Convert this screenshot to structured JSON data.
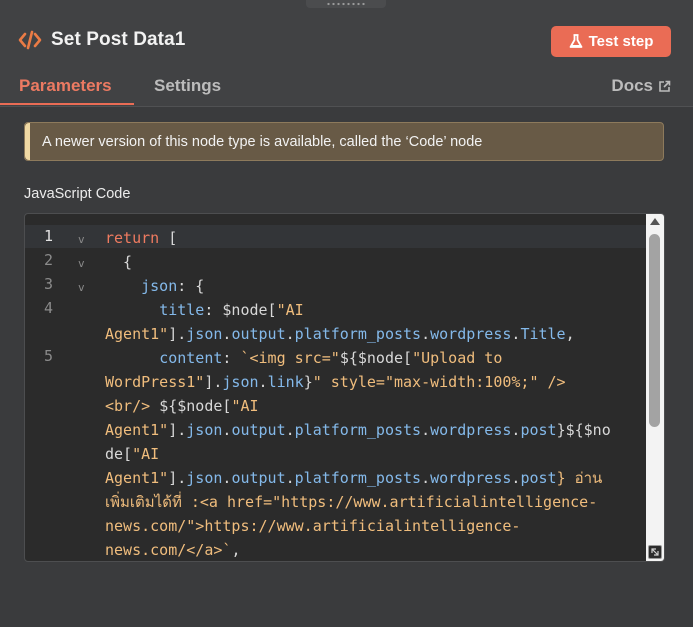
{
  "header": {
    "title": "Set Post Data1",
    "test_button_label": "Test step",
    "icon": "code-icon",
    "accent_color": "#ea6c55"
  },
  "tabs": [
    {
      "label": "Parameters",
      "active": true
    },
    {
      "label": "Settings",
      "active": false
    }
  ],
  "docs": {
    "label": "Docs",
    "icon": "external-link-icon"
  },
  "notice": {
    "text": "A newer version of this node type is available, called the ‘Code’ node"
  },
  "editor": {
    "label": "JavaScript Code",
    "line_numbers": [
      "1",
      "2",
      "3",
      "4",
      "5"
    ],
    "fold_markers": [
      "v",
      "v",
      "v"
    ],
    "lines": [
      [
        {
          "t": "return",
          "c": "kw"
        },
        {
          "t": " [",
          "c": ""
        }
      ],
      [
        {
          "t": "  {",
          "c": ""
        }
      ],
      [
        {
          "t": "    ",
          "c": ""
        },
        {
          "t": "json",
          "c": "prop"
        },
        {
          "t": ": {",
          "c": ""
        }
      ],
      [
        {
          "t": "      ",
          "c": ""
        },
        {
          "t": "title",
          "c": "prop"
        },
        {
          "t": ": $node[",
          "c": ""
        },
        {
          "t": "\"AI",
          "c": "str"
        }
      ],
      [
        {
          "t": "Agent1\"",
          "c": "str"
        },
        {
          "t": "].",
          "c": ""
        },
        {
          "t": "json",
          "c": "prop"
        },
        {
          "t": ".",
          "c": ""
        },
        {
          "t": "output",
          "c": "prop"
        },
        {
          "t": ".",
          "c": ""
        },
        {
          "t": "platform_posts",
          "c": "prop"
        },
        {
          "t": ".",
          "c": ""
        },
        {
          "t": "wordpress",
          "c": "prop"
        },
        {
          "t": ".",
          "c": ""
        },
        {
          "t": "Title",
          "c": "prop"
        },
        {
          "t": ",",
          "c": ""
        }
      ],
      [
        {
          "t": "      ",
          "c": ""
        },
        {
          "t": "content",
          "c": "prop"
        },
        {
          "t": ": ",
          "c": ""
        },
        {
          "t": "`<img src=\"",
          "c": "str"
        },
        {
          "t": "${$node[",
          "c": ""
        },
        {
          "t": "\"Upload to",
          "c": "str"
        }
      ],
      [
        {
          "t": "WordPress1\"",
          "c": "str"
        },
        {
          "t": "].",
          "c": ""
        },
        {
          "t": "json",
          "c": "prop"
        },
        {
          "t": ".",
          "c": ""
        },
        {
          "t": "link",
          "c": "prop"
        },
        {
          "t": "}",
          "c": ""
        },
        {
          "t": "\" style=\"max-width:100%;\" />",
          "c": "str"
        }
      ],
      [
        {
          "t": "<br/> ",
          "c": "str"
        },
        {
          "t": "${$node[",
          "c": ""
        },
        {
          "t": "\"AI",
          "c": "str"
        }
      ],
      [
        {
          "t": "Agent1\"",
          "c": "str"
        },
        {
          "t": "].",
          "c": ""
        },
        {
          "t": "json",
          "c": "prop"
        },
        {
          "t": ".",
          "c": ""
        },
        {
          "t": "output",
          "c": "prop"
        },
        {
          "t": ".",
          "c": ""
        },
        {
          "t": "platform_posts",
          "c": "prop"
        },
        {
          "t": ".",
          "c": ""
        },
        {
          "t": "wordpress",
          "c": "prop"
        },
        {
          "t": ".",
          "c": ""
        },
        {
          "t": "post",
          "c": "prop"
        },
        {
          "t": "}${$no",
          "c": ""
        }
      ],
      [
        {
          "t": "de[",
          "c": ""
        },
        {
          "t": "\"AI",
          "c": "str"
        }
      ],
      [
        {
          "t": "Agent1\"",
          "c": "str"
        },
        {
          "t": "].",
          "c": ""
        },
        {
          "t": "json",
          "c": "prop"
        },
        {
          "t": ".",
          "c": ""
        },
        {
          "t": "output",
          "c": "prop"
        },
        {
          "t": ".",
          "c": ""
        },
        {
          "t": "platform_posts",
          "c": "prop"
        },
        {
          "t": ".",
          "c": ""
        },
        {
          "t": "wordpress",
          "c": "prop"
        },
        {
          "t": ".",
          "c": ""
        },
        {
          "t": "post",
          "c": "prop"
        },
        {
          "t": "} อ่าน",
          "c": "str"
        }
      ],
      [
        {
          "t": "เพิ่มเติมได้ที่ :<a href=\"https://www.artificialintelligence-",
          "c": "str"
        }
      ],
      [
        {
          "t": "news.com/\">https://www.artificialintelligence-",
          "c": "str"
        }
      ],
      [
        {
          "t": "news.com/</a>`",
          "c": "str"
        },
        {
          "t": ",",
          "c": ""
        }
      ]
    ]
  }
}
